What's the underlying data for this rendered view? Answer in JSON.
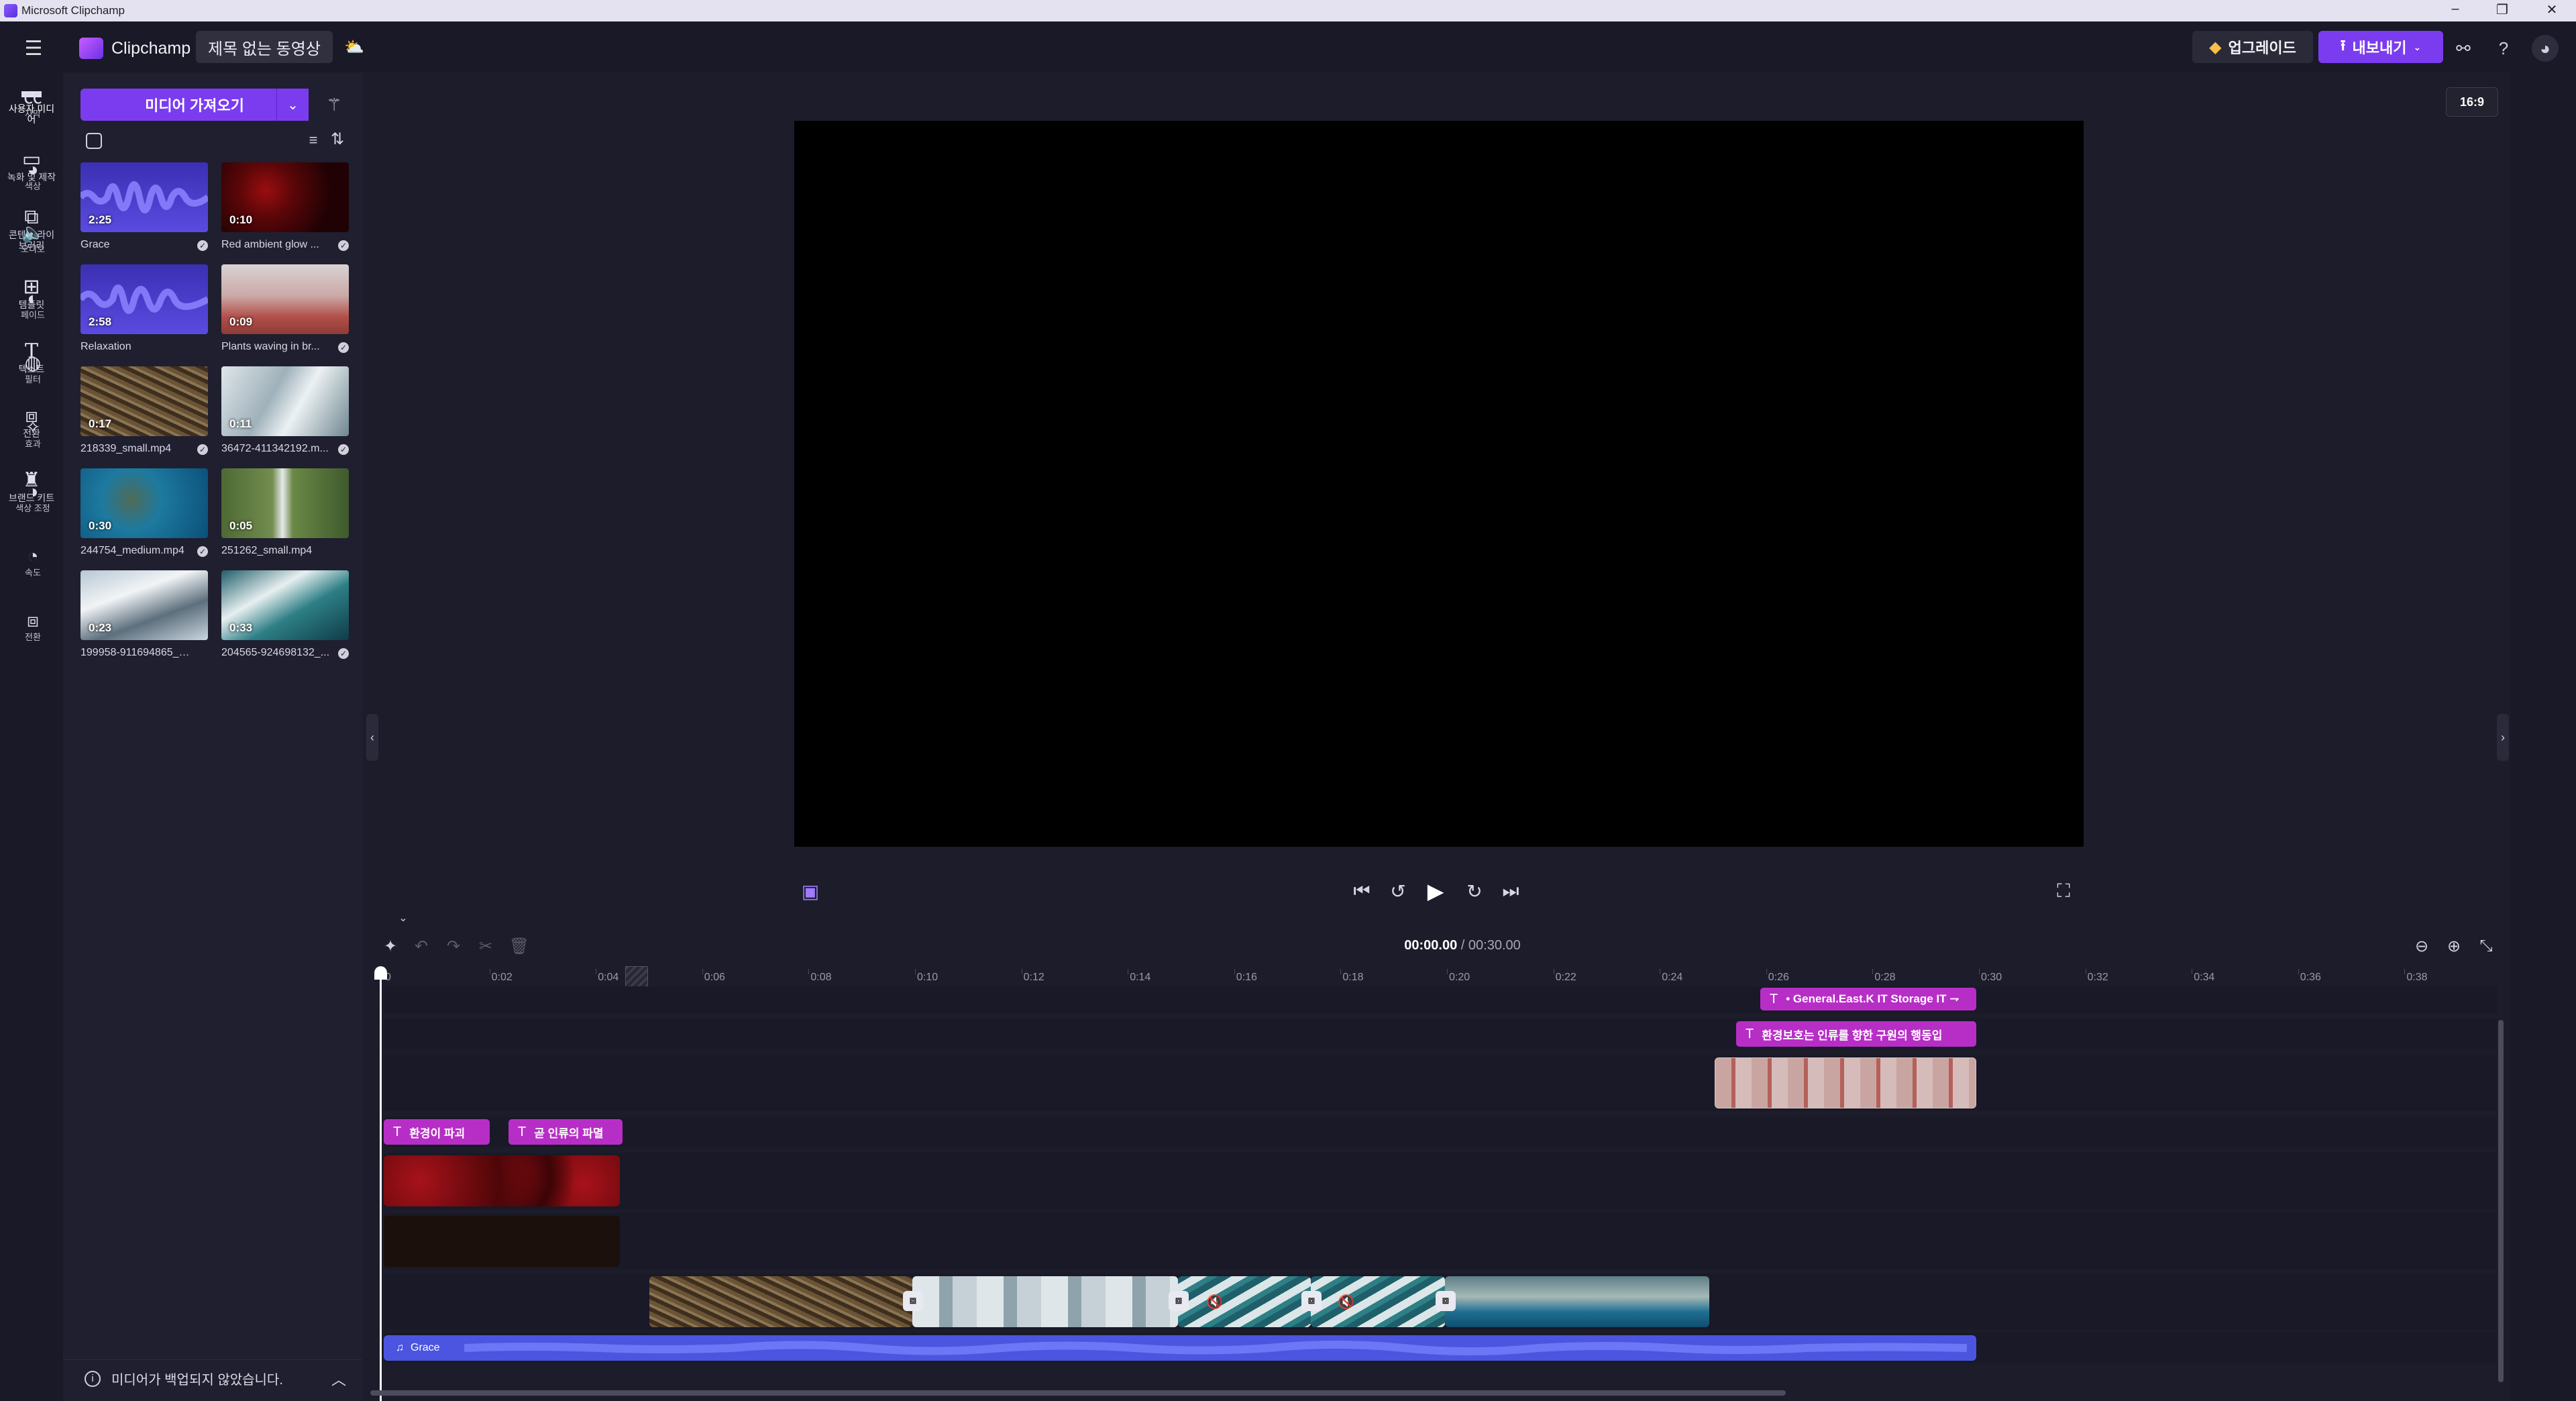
{
  "os": {
    "title": "Microsoft Clipchamp"
  },
  "header": {
    "brand": "Clipchamp",
    "project_title": "제목 없는 동영상",
    "upgrade_label": "업그레이드",
    "export_label": "내보내기"
  },
  "left_rail": {
    "items": [
      {
        "label": "사용자 미디어",
        "icon": "folder-icon"
      },
      {
        "label": "녹화 및 제작",
        "icon": "camera-icon"
      },
      {
        "label": "콘텐츠 라이브러리",
        "icon": "library-icon"
      },
      {
        "label": "템플릿",
        "icon": "templates-icon"
      },
      {
        "label": "텍스트",
        "icon": "text-icon"
      },
      {
        "label": "전환",
        "icon": "transition-icon"
      },
      {
        "label": "브랜드 키트",
        "icon": "brand-kit-icon"
      }
    ]
  },
  "media": {
    "import_label": "미디어 가져오기",
    "items": [
      {
        "name": "Grace",
        "duration": "2:25",
        "kind": "audio"
      },
      {
        "name": "Red ambient glow ...",
        "duration": "0:10",
        "kind": "red"
      },
      {
        "name": "Relaxation",
        "duration": "2:58",
        "kind": "audio"
      },
      {
        "name": "Plants waving in br...",
        "duration": "0:09",
        "kind": "plants"
      },
      {
        "name": "218339_small.mp4",
        "duration": "0:17",
        "kind": "branches"
      },
      {
        "name": "36472-411342192.m...",
        "duration": "0:11",
        "kind": "glacier"
      },
      {
        "name": "244754_medium.mp4",
        "duration": "0:30",
        "kind": "ocean"
      },
      {
        "name": "251262_small.mp4",
        "duration": "0:05",
        "kind": "waterfall"
      },
      {
        "name": "199958-911694865_me...",
        "duration": "0:23",
        "kind": "snow"
      },
      {
        "name": "204565-924698132_...",
        "duration": "0:33",
        "kind": "waves"
      }
    ],
    "backup_notice": "미디어가 백업되지 않았습니다."
  },
  "preview": {
    "aspect_ratio": "16:9"
  },
  "right_rail": {
    "items": [
      {
        "label": "자막",
        "icon": "captions-icon"
      },
      {
        "label": "색상",
        "icon": "palette-icon"
      },
      {
        "label": "오디오",
        "icon": "speaker-icon"
      },
      {
        "label": "페이드",
        "icon": "fade-icon"
      },
      {
        "label": "필터",
        "icon": "filter-icon"
      },
      {
        "label": "효과",
        "icon": "effects-icon"
      },
      {
        "label": "색상 조정",
        "icon": "color-adjust-icon"
      },
      {
        "label": "속도",
        "icon": "speed-icon"
      },
      {
        "label": "전환",
        "icon": "transition-icon"
      }
    ]
  },
  "timeline": {
    "current_time": "00:00.00",
    "total_time": "/ 00:30.00",
    "ruler": [
      "0",
      "0:02",
      "0:04",
      "0:06",
      "0:08",
      "0:10",
      "0:12",
      "0:14",
      "0:16",
      "0:18",
      "0:20",
      "0:22",
      "0:24",
      "0:26",
      "0:28",
      "0:30",
      "0:32",
      "0:34",
      "0:36",
      "0:38"
    ],
    "text_clips": {
      "general": "• General.East.K IT Storage IT ⇁",
      "protect": "환경보호는 인류를 향한 구원의 행동입",
      "destroy": "환경이 파괴",
      "soon": "곧 인류의 파멸"
    },
    "audio_clip_label": "Grace"
  },
  "colors": {
    "accent": "#7b3cf0",
    "text_clip": "#b72ec6",
    "audio_clip": "#4b55e0"
  }
}
